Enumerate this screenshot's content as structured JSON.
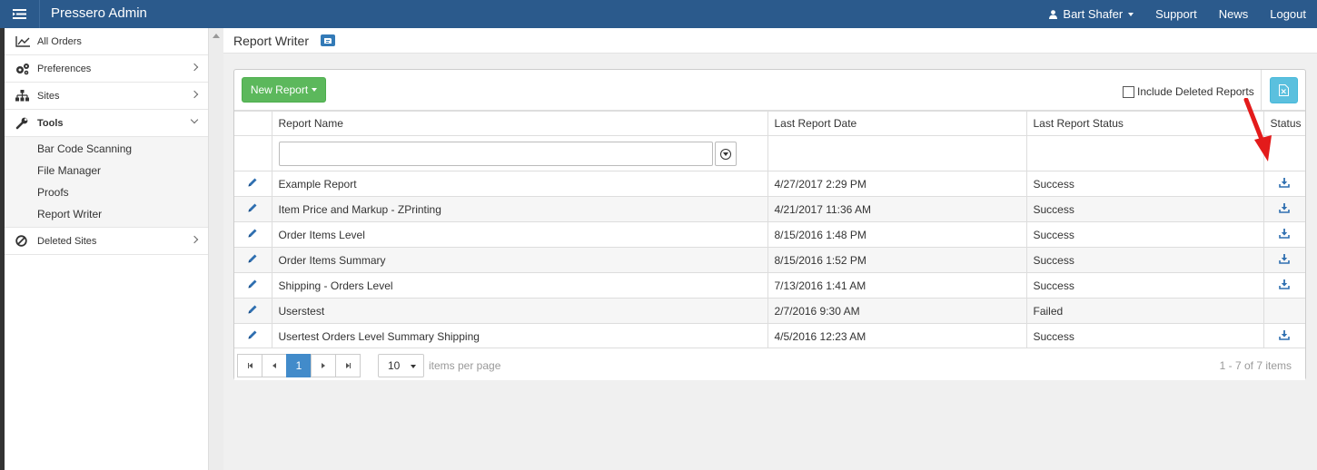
{
  "topbar": {
    "title": "Pressero Admin",
    "user": "Bart Shafer",
    "links": [
      "Support",
      "News",
      "Logout"
    ]
  },
  "sidebar": {
    "items": [
      {
        "label": "All Orders",
        "icon": "line-chart-icon"
      },
      {
        "label": "Preferences",
        "icon": "gears-icon"
      },
      {
        "label": "Sites",
        "icon": "sitemap-icon"
      },
      {
        "label": "Tools",
        "icon": "wrench-icon"
      },
      {
        "label": "Deleted Sites",
        "icon": "ban-icon"
      }
    ],
    "tools_sub": [
      "Bar Code Scanning",
      "File Manager",
      "Proofs",
      "Report Writer"
    ]
  },
  "page": {
    "title": "Report Writer"
  },
  "toolbar": {
    "new_report": "New Report",
    "include_deleted": "Include Deleted Reports"
  },
  "table": {
    "columns": [
      "Report Name",
      "Last Report Date",
      "Last Report Status",
      "Status"
    ],
    "rows": [
      {
        "name": "Example Report",
        "date": "4/27/2017 2:29 PM",
        "status": "Success",
        "download": true
      },
      {
        "name": "Item Price and Markup - ZPrinting",
        "date": "4/21/2017 11:36 AM",
        "status": "Success",
        "download": true
      },
      {
        "name": "Order Items Level",
        "date": "8/15/2016 1:48 PM",
        "status": "Success",
        "download": true
      },
      {
        "name": "Order Items Summary",
        "date": "8/15/2016 1:52 PM",
        "status": "Success",
        "download": true
      },
      {
        "name": "Shipping - Orders Level",
        "date": "7/13/2016 1:41 AM",
        "status": "Success",
        "download": true
      },
      {
        "name": "Userstest",
        "date": "2/7/2016 9:30 AM",
        "status": "Failed",
        "download": false
      },
      {
        "name": "Usertest Orders Level Summary Shipping",
        "date": "4/5/2016 12:23 AM",
        "status": "Success",
        "download": true
      }
    ]
  },
  "pager": {
    "current_page": "1",
    "page_size": "10",
    "per_page_label": "items per page",
    "info": "1 - 7 of 7 items"
  },
  "colors": {
    "topbar": "#2b5a8c",
    "new_button": "#5cb85c",
    "export_button": "#5bc0de",
    "active_page": "#428bca",
    "icon_blue": "#2f6fb0",
    "annotation_arrow": "#e31b1b"
  }
}
